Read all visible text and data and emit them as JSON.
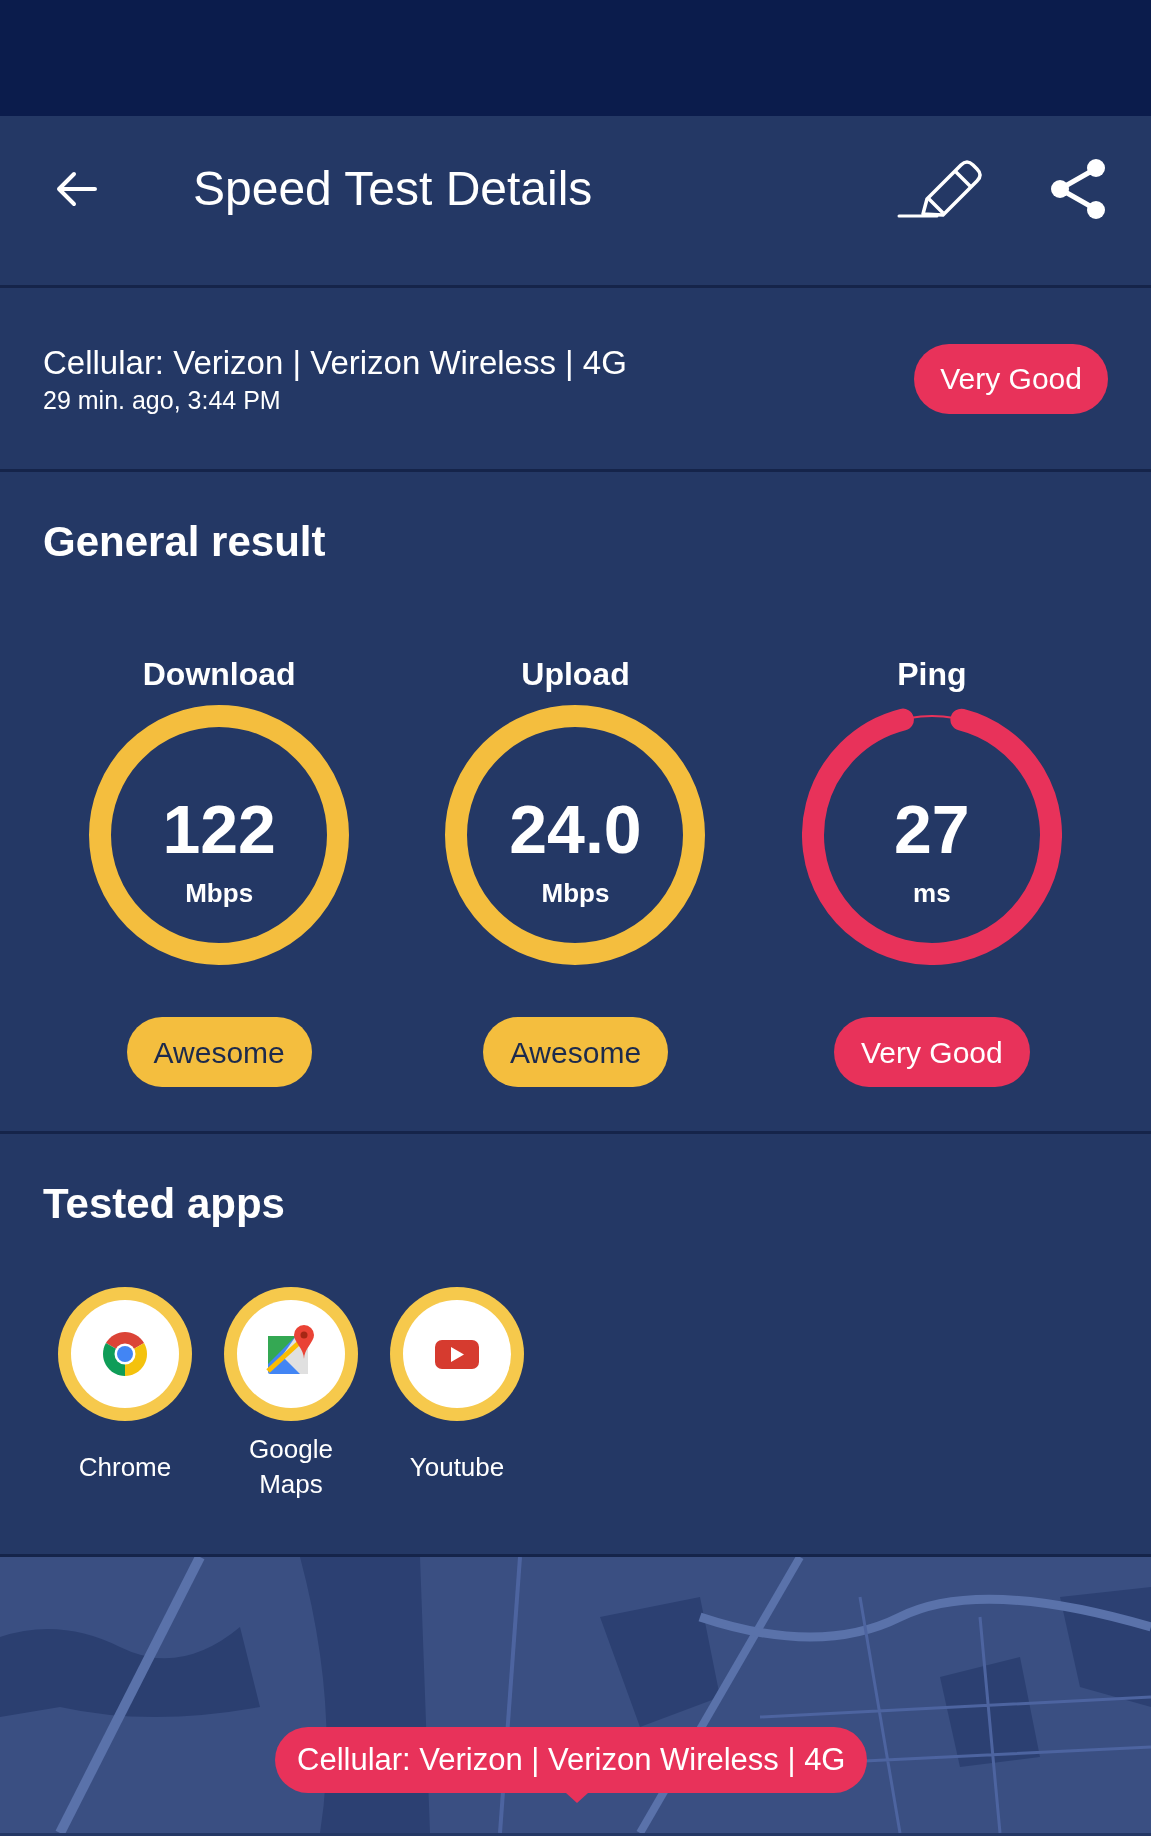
{
  "toolbar": {
    "title": "Speed Test Details"
  },
  "connection": {
    "name": "Cellular: Verizon | Verizon Wireless | 4G",
    "time": "29 min. ago, 3:44 PM",
    "rating": "Very Good"
  },
  "general_result": {
    "title": "General result",
    "metrics": [
      {
        "label": "Download",
        "value": "122",
        "unit": "Mbps",
        "level": 1,
        "color": "#f4be3e",
        "rating": "Awesome"
      },
      {
        "label": "Upload",
        "value": "24.0",
        "unit": "Mbps",
        "level": 1,
        "color": "#f4be3e",
        "rating": "Awesome"
      },
      {
        "label": "Ping",
        "value": "27",
        "unit": "ms",
        "level": 0.95,
        "color": "#e8325a",
        "rating": "Very Good"
      }
    ]
  },
  "tested_apps": {
    "title": "Tested apps",
    "apps": [
      {
        "name": "Chrome",
        "kind": "chrome"
      },
      {
        "name": "Google Maps",
        "kind": "maps"
      },
      {
        "name": "Youtube",
        "kind": "youtube"
      }
    ]
  },
  "map": {
    "tooltip": "Cellular: Verizon | Verizon Wireless | 4G"
  }
}
